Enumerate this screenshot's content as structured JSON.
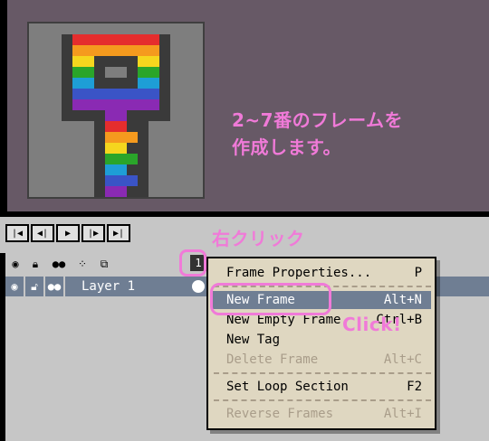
{
  "annotations": {
    "main_line1": "2~7番のフレームを",
    "main_line2": "作成します。",
    "right_click": "右クリック",
    "click": "Click!"
  },
  "colors": {
    "accent_pink": "#f07ad8",
    "canvas_bg": "#675966",
    "selection": "#6f7e93",
    "menu_bg": "#dfd7c1"
  },
  "playback": {
    "buttons": [
      "first-frame-icon",
      "prev-frame-icon",
      "play-icon",
      "next-frame-icon",
      "last-frame-icon"
    ]
  },
  "timeline": {
    "header_icons": [
      "eye-icon",
      "lock-icon",
      "continuous-icon",
      "onion-skin-icon",
      "frame-icon"
    ],
    "frame_number": "1",
    "layer": {
      "name": "Layer 1",
      "icons": [
        "eye-icon",
        "unlock-icon",
        "continuous-icon"
      ]
    }
  },
  "context_menu": {
    "items": [
      {
        "label": "Frame Properties...",
        "shortcut": "P",
        "enabled": true,
        "underline": "F"
      },
      {
        "label": "New Frame",
        "shortcut": "Alt+N",
        "enabled": true,
        "highlighted": true,
        "underline": "N"
      },
      {
        "label": "New Empty Frame",
        "shortcut": "Ctrl+B",
        "enabled": true,
        "underline": "E"
      },
      {
        "label": "New Tag",
        "shortcut": "",
        "enabled": true,
        "underline": "T"
      },
      {
        "label": "Delete Frame",
        "shortcut": "Alt+C",
        "enabled": false,
        "underline": "D"
      },
      {
        "label": "Set Loop Section",
        "shortcut": "F2",
        "enabled": true,
        "underline": "L"
      },
      {
        "label": "Reverse Frames",
        "shortcut": "Alt+I",
        "enabled": false,
        "underline": "v"
      }
    ]
  }
}
